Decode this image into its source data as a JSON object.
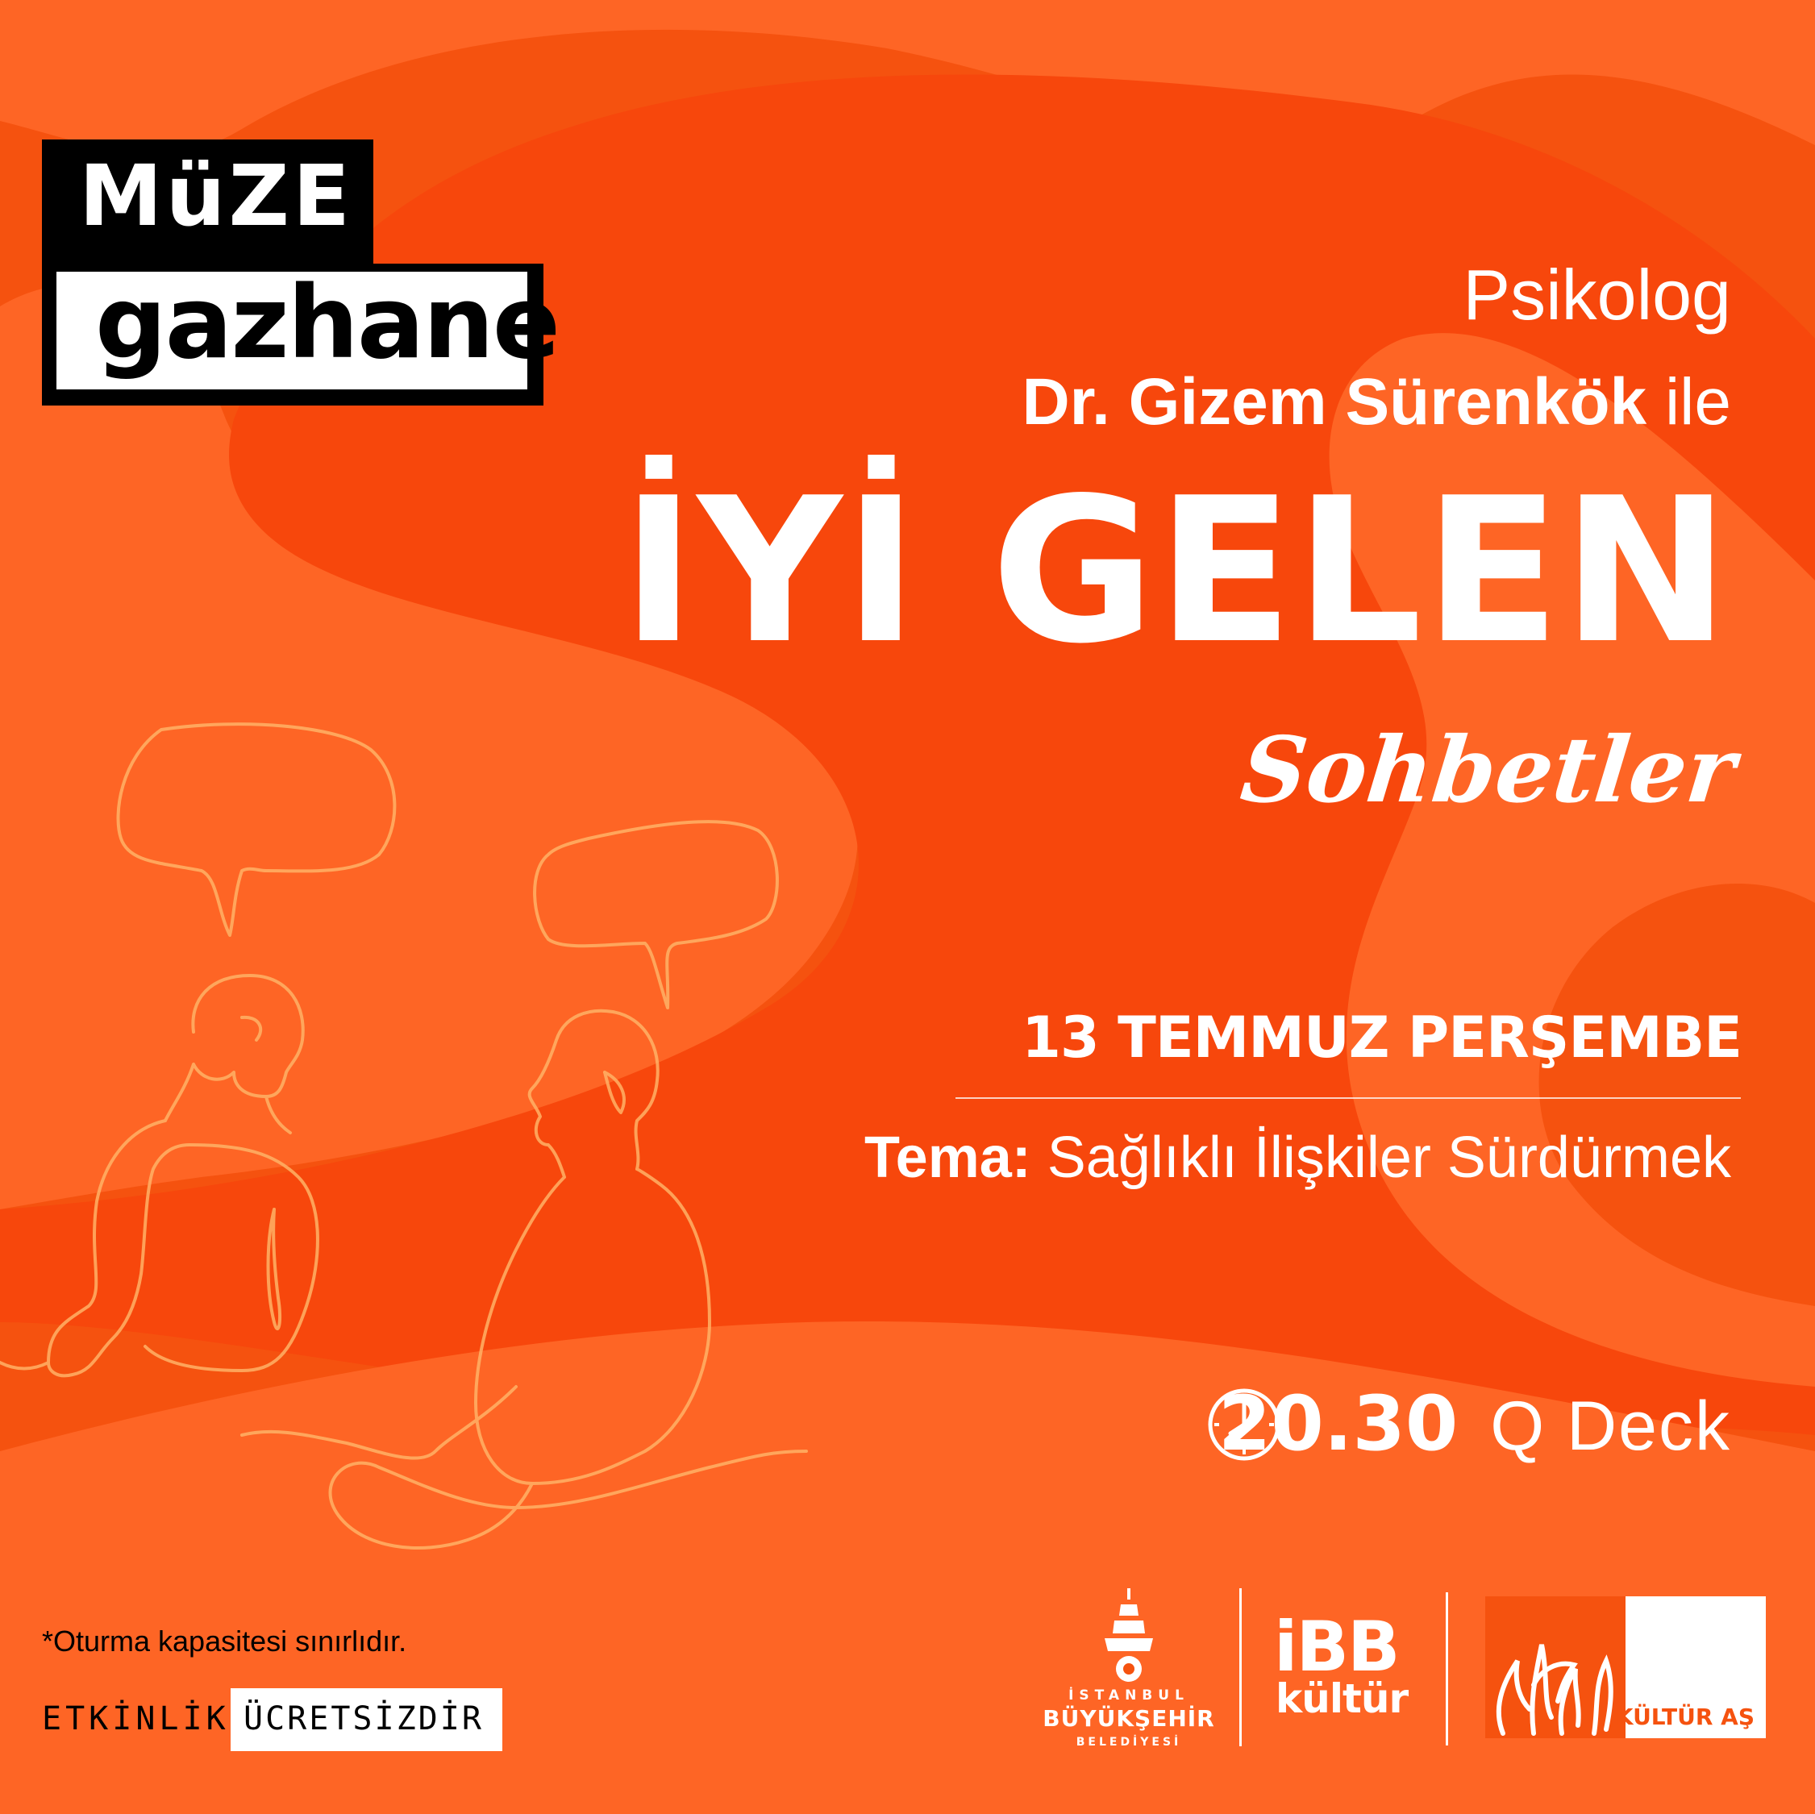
{
  "colors": {
    "background": "#f5520f",
    "shape_light": "#fe6525",
    "shape_dark": "#f7470c",
    "line_art": "#ffb266",
    "text": "#ffffff",
    "dark": "#000000"
  },
  "logo": {
    "line1": "MüZE",
    "line2": "gazhane"
  },
  "header": {
    "psikolog": "Psikolog",
    "name_bold": "Dr. Gizem Sürenkök",
    "name_tail": "ile"
  },
  "title": {
    "main": "İYİ GELEN",
    "sub": "Sohbetler"
  },
  "event": {
    "date": "13 TEMMUZ PERŞEMBE",
    "theme_label": "Tema:",
    "theme_value": "Sağlıklı İlişkiler Sürdürmek",
    "time": "20.30",
    "venue": "Q Deck",
    "clock_icon": "clock-icon"
  },
  "footer": {
    "note": "*Oturma kapasitesi sınırlıdır.",
    "etkinlik": "ETKİNLİK",
    "ucretsiz": "ÜCRETSİZDİR"
  },
  "sponsors": {
    "ibb_line1": "İSTANBUL",
    "ibb_line2": "BÜYÜKŞEHİR",
    "ibb_line3": "BELEDİYESİ",
    "ibb_kultur_line1": "iBB",
    "ibb_kultur_line2": "kültür",
    "kultur_as": "KÜLTÜR AŞ"
  }
}
